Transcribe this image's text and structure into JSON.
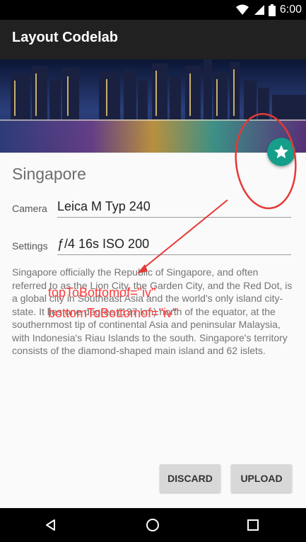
{
  "status_bar": {
    "time": "6:00"
  },
  "app_bar": {
    "title": "Layout Codelab"
  },
  "hero": {
    "image": "city skyline at night (Singapore)"
  },
  "fab": {
    "icon": "star-icon",
    "color": "#159e8a"
  },
  "place": {
    "name": "Singapore"
  },
  "fields": {
    "camera": {
      "label": "Camera",
      "value": "Leica M Typ 240"
    },
    "settings": {
      "label": "Settings",
      "value": "ƒ/4 16s ISO 200"
    }
  },
  "description": "Singapore officially the Republic of Singapore, and often referred to as the Lion City, the Garden City, and the Red Dot, is a global city in Southeast Asia and the world's only island city-state. It lies one degree (137 km) north of the equator, at the southernmost tip of continental Asia and peninsular Malaysia, with Indonesia's Riau Islands to the south. Singapore's territory consists of the diamond-shaped main island and 62 islets.",
  "annotation": {
    "line1": "topToBottomof=\"iv\"",
    "line2": "bottomToBottomof=\"iv\"",
    "color": "#ff3b3b"
  },
  "buttons": {
    "discard": "DISCARD",
    "upload": "UPLOAD"
  },
  "nav": {
    "back": "back-icon",
    "home": "home-icon",
    "recents": "recents-icon"
  }
}
